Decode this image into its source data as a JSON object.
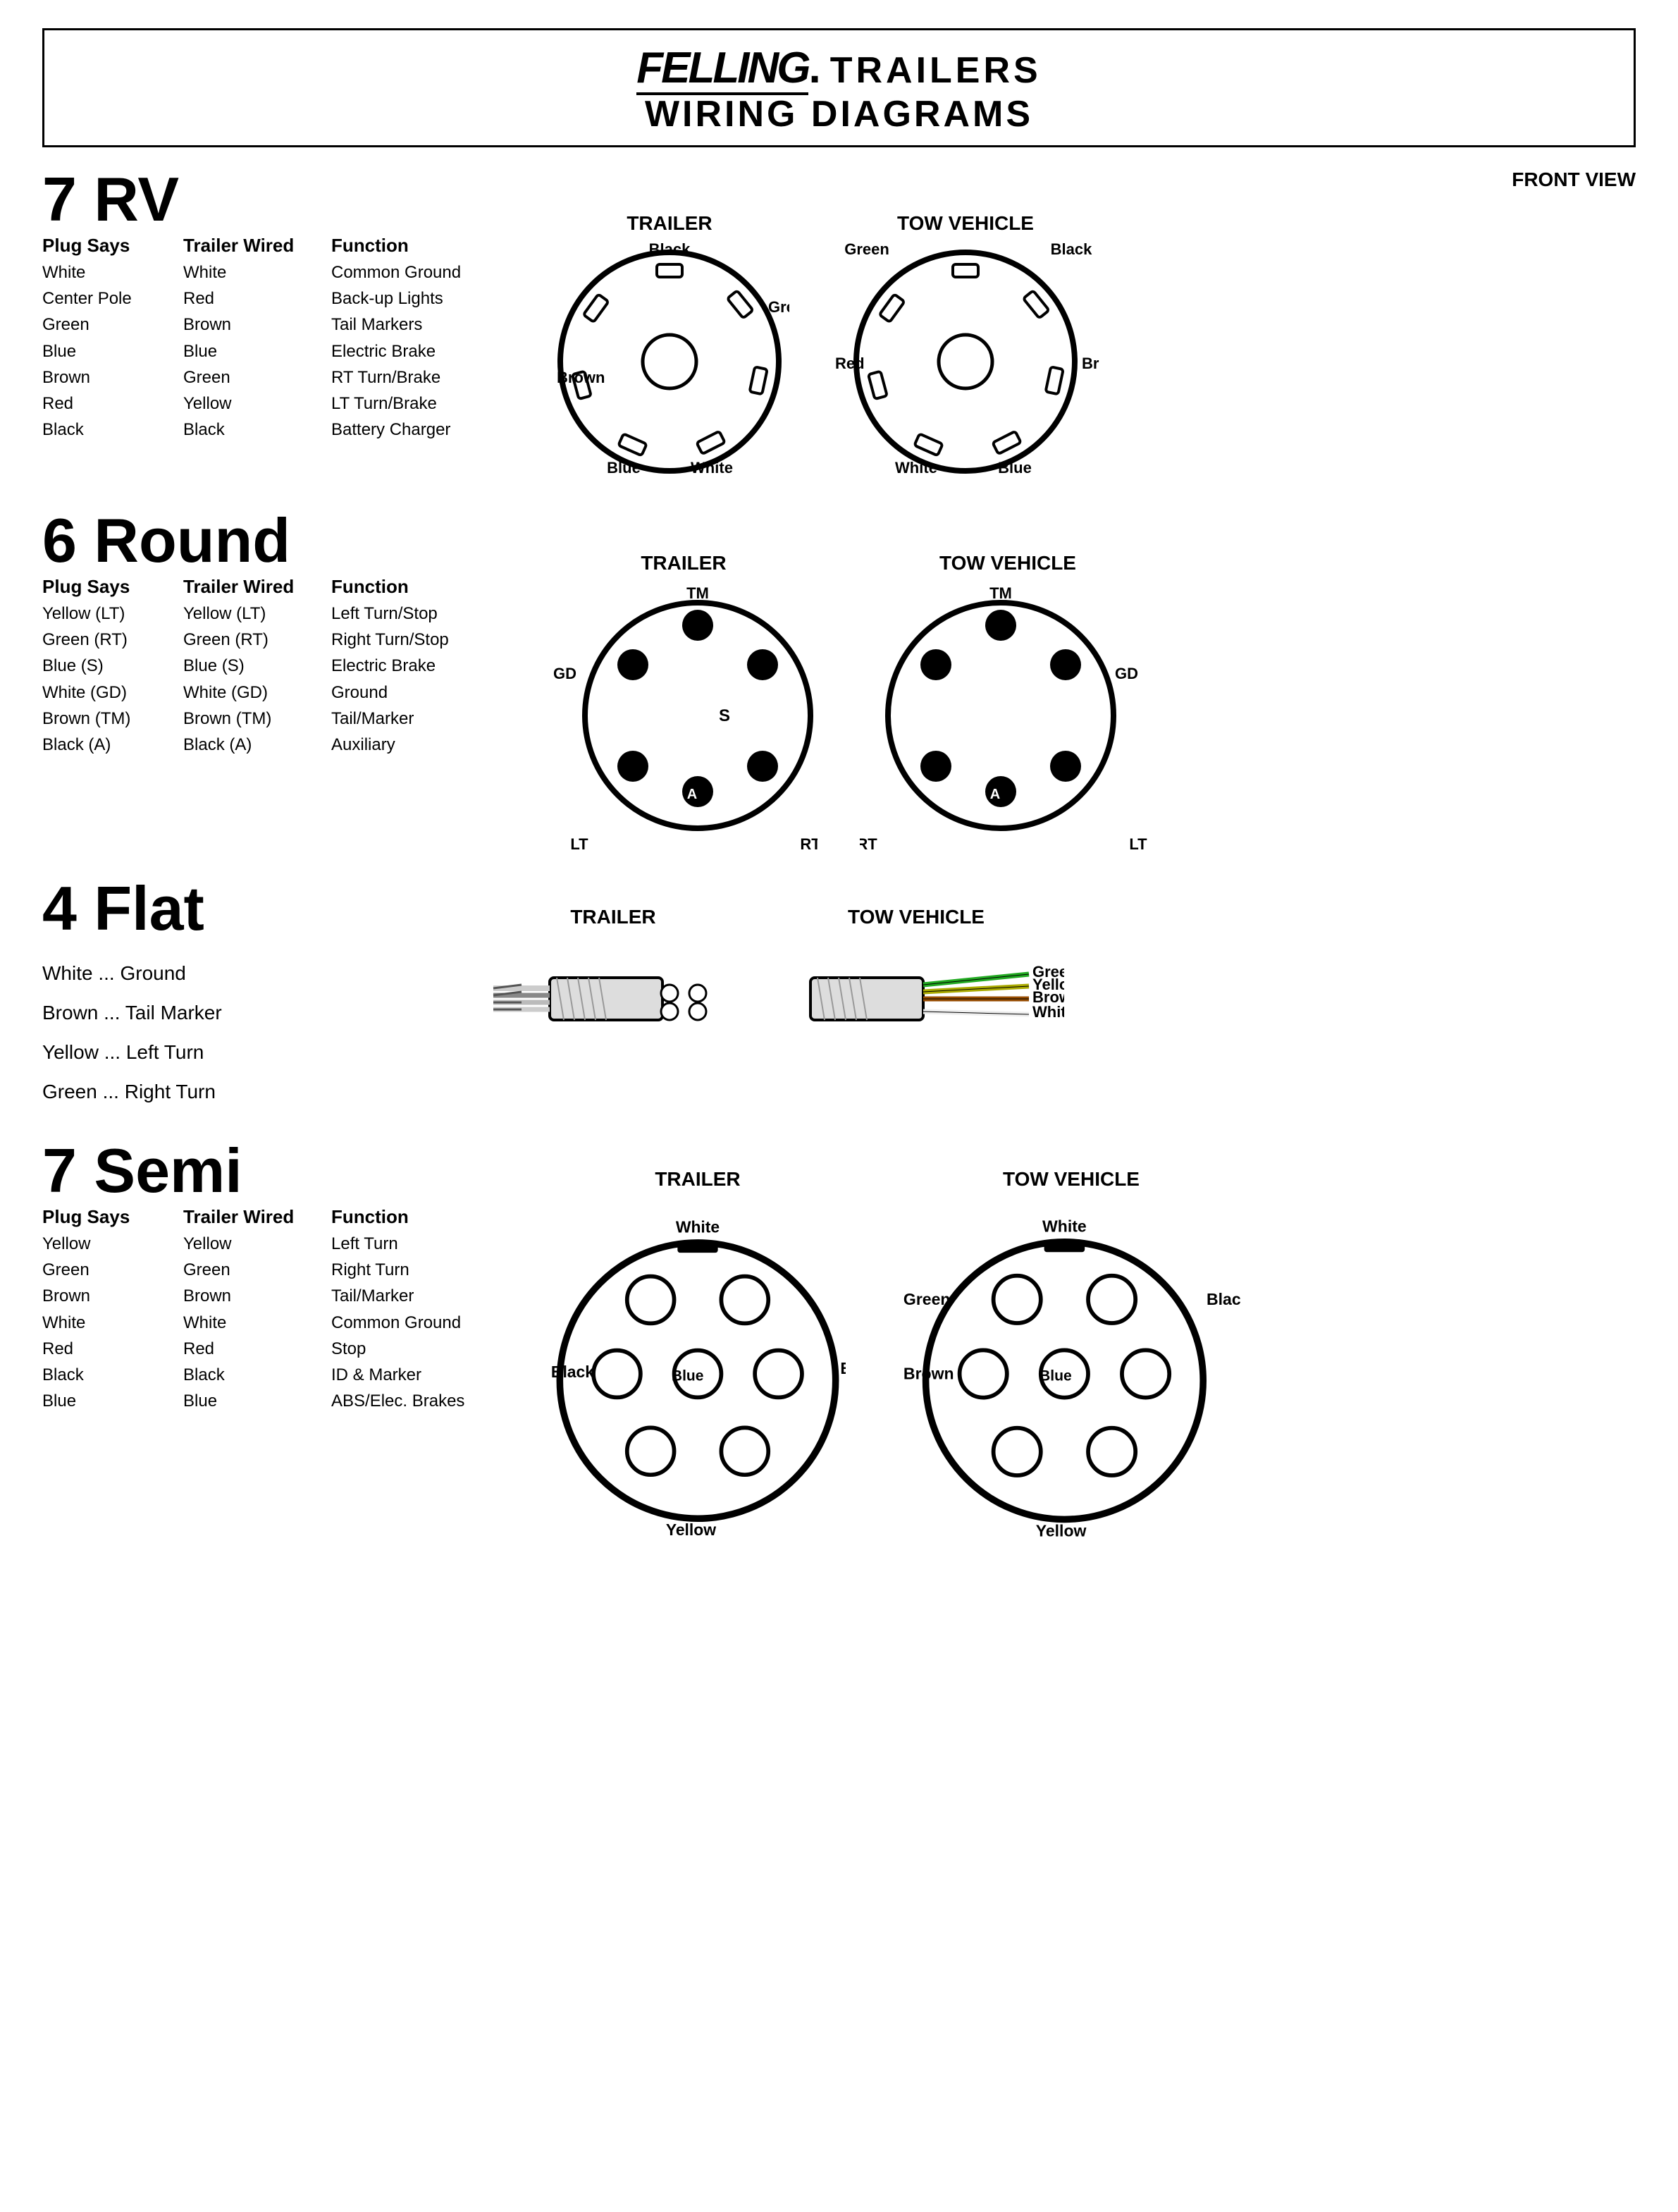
{
  "header": {
    "brand": "FELLING",
    "trailers": "TRAILERS",
    "wiring_diagrams": "WIRING DIAGRAMS"
  },
  "front_view_label": "FRONT VIEW",
  "rv7": {
    "title": "7 RV",
    "col_plug": "Plug Says",
    "col_wired": "Trailer Wired",
    "col_func": "Function",
    "rows": [
      {
        "plug": "White",
        "wired": "White",
        "func": "Common Ground"
      },
      {
        "plug": "Center Pole",
        "wired": "Red",
        "func": "Back-up Lights"
      },
      {
        "plug": "Green",
        "wired": "Brown",
        "func": "Tail Markers"
      },
      {
        "plug": "Blue",
        "wired": "Blue",
        "func": "Electric Brake"
      },
      {
        "plug": "Brown",
        "wired": "Green",
        "func": "RT Turn/Brake"
      },
      {
        "plug": "Red",
        "wired": "Yellow",
        "func": "LT Turn/Brake"
      },
      {
        "plug": "Black",
        "wired": "Black",
        "func": "Battery Charger"
      }
    ],
    "trailer_label": "TRAILER",
    "tow_label": "TOW VEHICLE",
    "trailer_pins": {
      "top": "Black",
      "top_right": "Green",
      "right": "",
      "bottom_right": "",
      "bottom": "White",
      "bottom_left": "Blue",
      "left": "Brown"
    },
    "tow_pins": {
      "top_left": "Green",
      "top_right": "Black",
      "right": "Brown",
      "bottom_right": "Blue",
      "bottom": "White",
      "left": "Red"
    }
  },
  "round6": {
    "title": "6 Round",
    "col_plug": "Plug Says",
    "col_wired": "Trailer Wired",
    "col_func": "Function",
    "rows": [
      {
        "plug": "Yellow (LT)",
        "wired": "Yellow (LT)",
        "func": "Left Turn/Stop"
      },
      {
        "plug": "Green (RT)",
        "wired": "Green (RT)",
        "func": "Right Turn/Stop"
      },
      {
        "plug": "Blue (S)",
        "wired": "Blue (S)",
        "func": "Electric Brake"
      },
      {
        "plug": "White (GD)",
        "wired": "White (GD)",
        "func": "Ground"
      },
      {
        "plug": "Brown (TM)",
        "wired": "Brown (TM)",
        "func": "Tail/Marker"
      },
      {
        "plug": "Black (A)",
        "wired": "Black (A)",
        "func": "Auxiliary"
      }
    ],
    "trailer_label": "TRAILER",
    "tow_label": "TOW VEHICLE",
    "trailer_pins": {
      "top": "TM",
      "left": "GD",
      "center_label": "S",
      "bottom_left": "LT",
      "bottom_right": "RT",
      "bottom_center_label": "A"
    },
    "tow_pins": {
      "top": "TM",
      "right": "GD",
      "bottom_left": "RT",
      "bottom_right": "LT",
      "bottom_center_label": "A"
    }
  },
  "flat4": {
    "title": "4 Flat",
    "trailer_label": "TRAILER",
    "tow_label": "TOW VEHICLE",
    "wires": [
      {
        "color": "White",
        "dots": "...",
        "func": "Ground"
      },
      {
        "color": "Brown",
        "dots": "...",
        "func": "Tail Marker"
      },
      {
        "color": "Yellow",
        "dots": "...",
        "func": "Left Turn"
      },
      {
        "color": "Green",
        "dots": "...",
        "func": "Right Turn"
      }
    ],
    "tow_wires": [
      "Green",
      "Yellow",
      "Brown",
      "White"
    ]
  },
  "semi7": {
    "title": "7 Semi",
    "col_plug": "Plug Says",
    "col_wired": "Trailer Wired",
    "col_func": "Function",
    "rows": [
      {
        "plug": "Yellow",
        "wired": "Yellow",
        "func": "Left Turn"
      },
      {
        "plug": "Green",
        "wired": "Green",
        "func": "Right Turn"
      },
      {
        "plug": "Brown",
        "wired": "Brown",
        "func": "Tail/Marker"
      },
      {
        "plug": "White",
        "wired": "White",
        "func": "Common Ground"
      },
      {
        "plug": "Red",
        "wired": "Red",
        "func": "Stop"
      },
      {
        "plug": "Black",
        "wired": "Black",
        "func": "ID & Marker"
      },
      {
        "plug": "Blue",
        "wired": "Blue",
        "func": "ABS/Elec. Brakes"
      }
    ],
    "trailer_label": "TRAILER",
    "tow_label": "TOW VEHICLE",
    "trailer_pins": {
      "top": "White",
      "left": "Black",
      "center": "Blue",
      "bottom": "Yellow",
      "right_labels": [
        "Brown"
      ]
    },
    "tow_pins": {
      "top": "White",
      "right": "Black",
      "center": "Blue",
      "bottom": "Yellow",
      "left_labels": [
        "Brown",
        "Green"
      ]
    }
  }
}
